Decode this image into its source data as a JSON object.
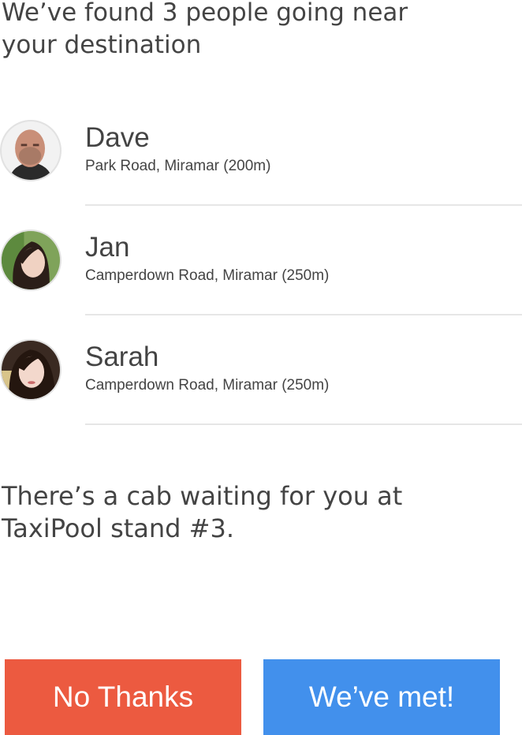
{
  "header": {
    "title_line1": "We’ve found 3 people going near",
    "title_line2": "your destination"
  },
  "people": [
    {
      "name": "Dave",
      "location": "Park Road, Miramar (200m)"
    },
    {
      "name": "Jan",
      "location": "Camperdown Road, Miramar (250m)"
    },
    {
      "name": "Sarah",
      "location": "Camperdown Road, Miramar (250m)"
    }
  ],
  "message": {
    "line1": "There’s a cab waiting for you at",
    "line2": "TaxiPool stand #3."
  },
  "actions": {
    "decline_label": "No Thanks",
    "confirm_label": "We’ve met!"
  },
  "colors": {
    "decline": "#ec5a40",
    "confirm": "#4290ec",
    "text": "#444444",
    "divider": "#e6e6e6"
  }
}
